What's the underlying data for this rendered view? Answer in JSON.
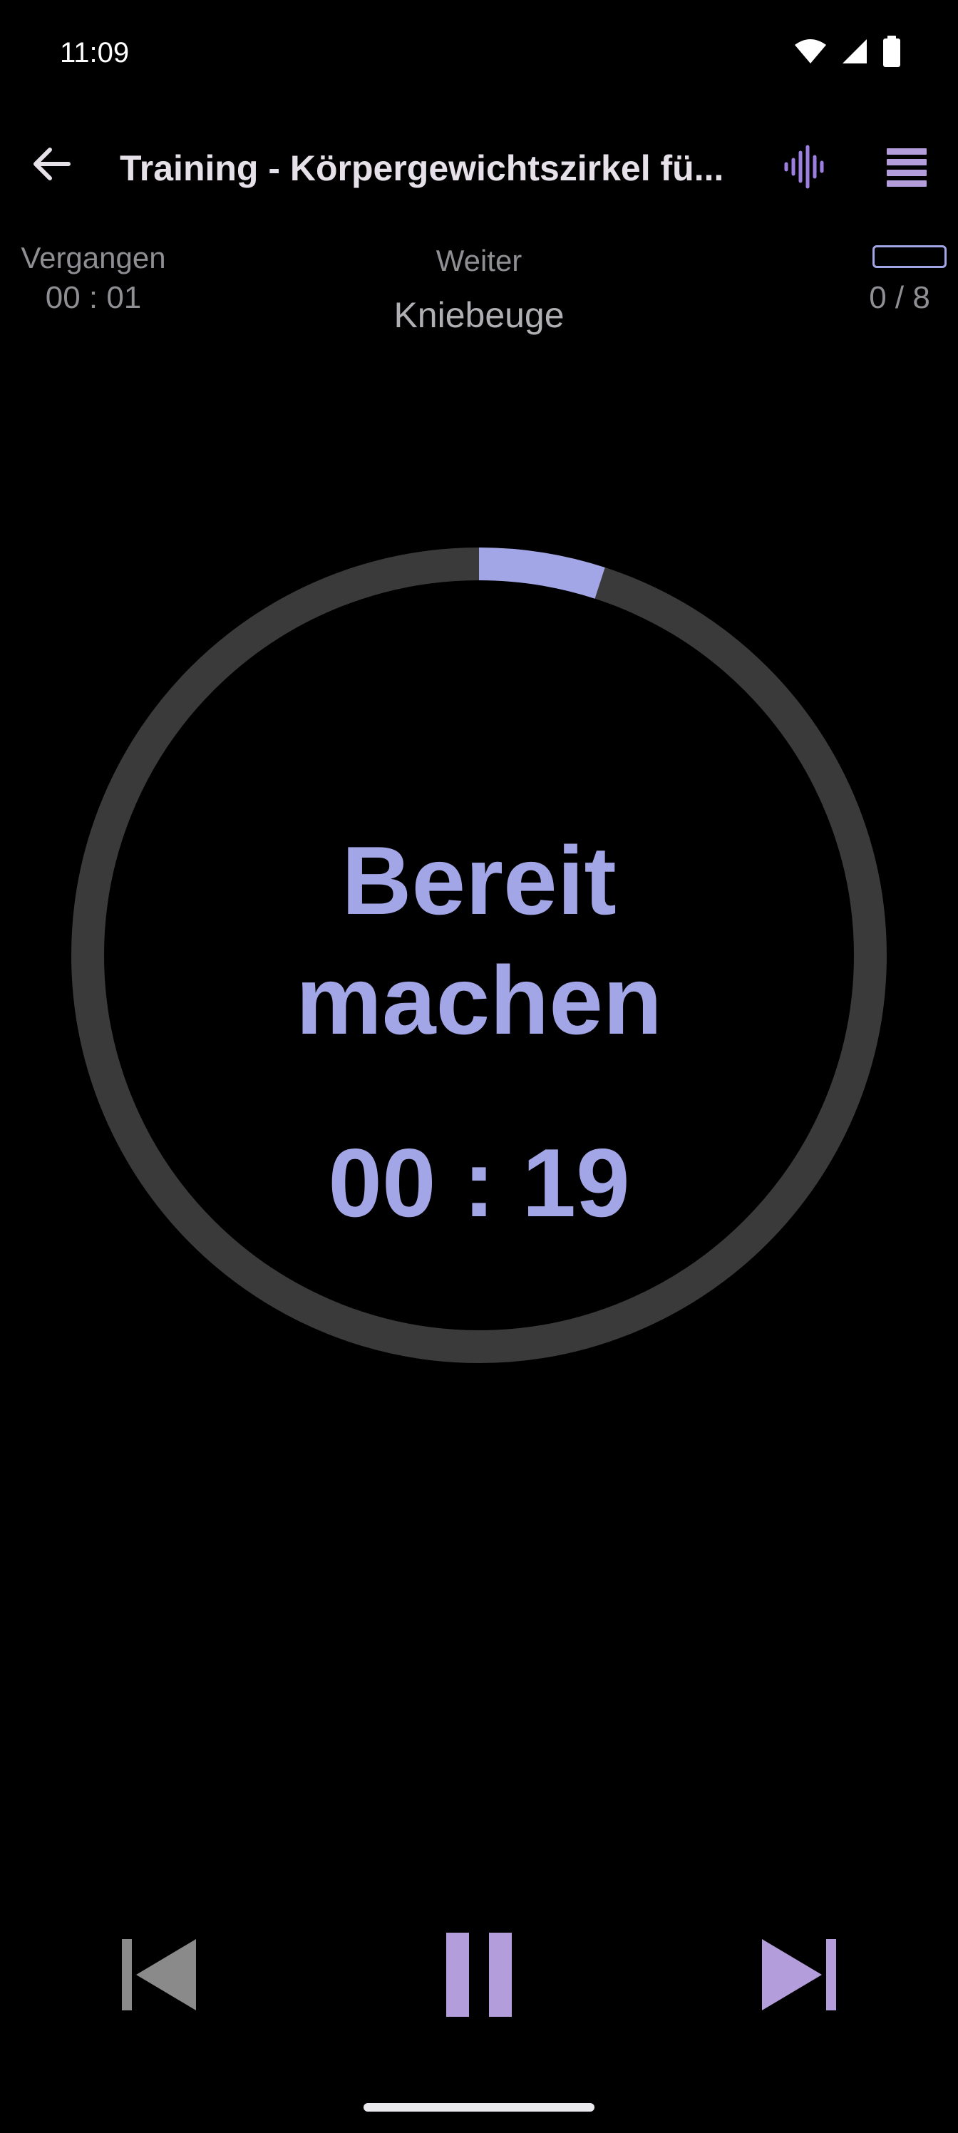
{
  "status_bar": {
    "time": "11:09",
    "icons": [
      "wifi-icon",
      "signal-icon",
      "battery-icon"
    ]
  },
  "app_bar": {
    "title": "Training - Körpergewichtszirkel fü...",
    "back_icon": "arrow-left-icon",
    "sound_icon": "waveform-icon",
    "menu_icon": "list-icon"
  },
  "info": {
    "elapsed_label": "Vergangen",
    "elapsed_value": "00 : 01",
    "next_label": "Weiter",
    "next_exercise": "Kniebeuge",
    "progress_count": "0 / 8",
    "progress_fraction": 0
  },
  "timer": {
    "phase_line1": "Bereit",
    "phase_line2": "machen",
    "countdown": "00 : 19",
    "ring_progress": 0.05
  },
  "controls": {
    "previous_icon": "skip-previous-icon",
    "pause_icon": "pause-icon",
    "next_icon": "skip-next-icon"
  },
  "colors": {
    "accent": "#a3a6e6",
    "accent_purple": "#b39ddb",
    "ring_track": "#3a3a3a",
    "background": "#000000",
    "disabled": "#8a8a8a"
  }
}
